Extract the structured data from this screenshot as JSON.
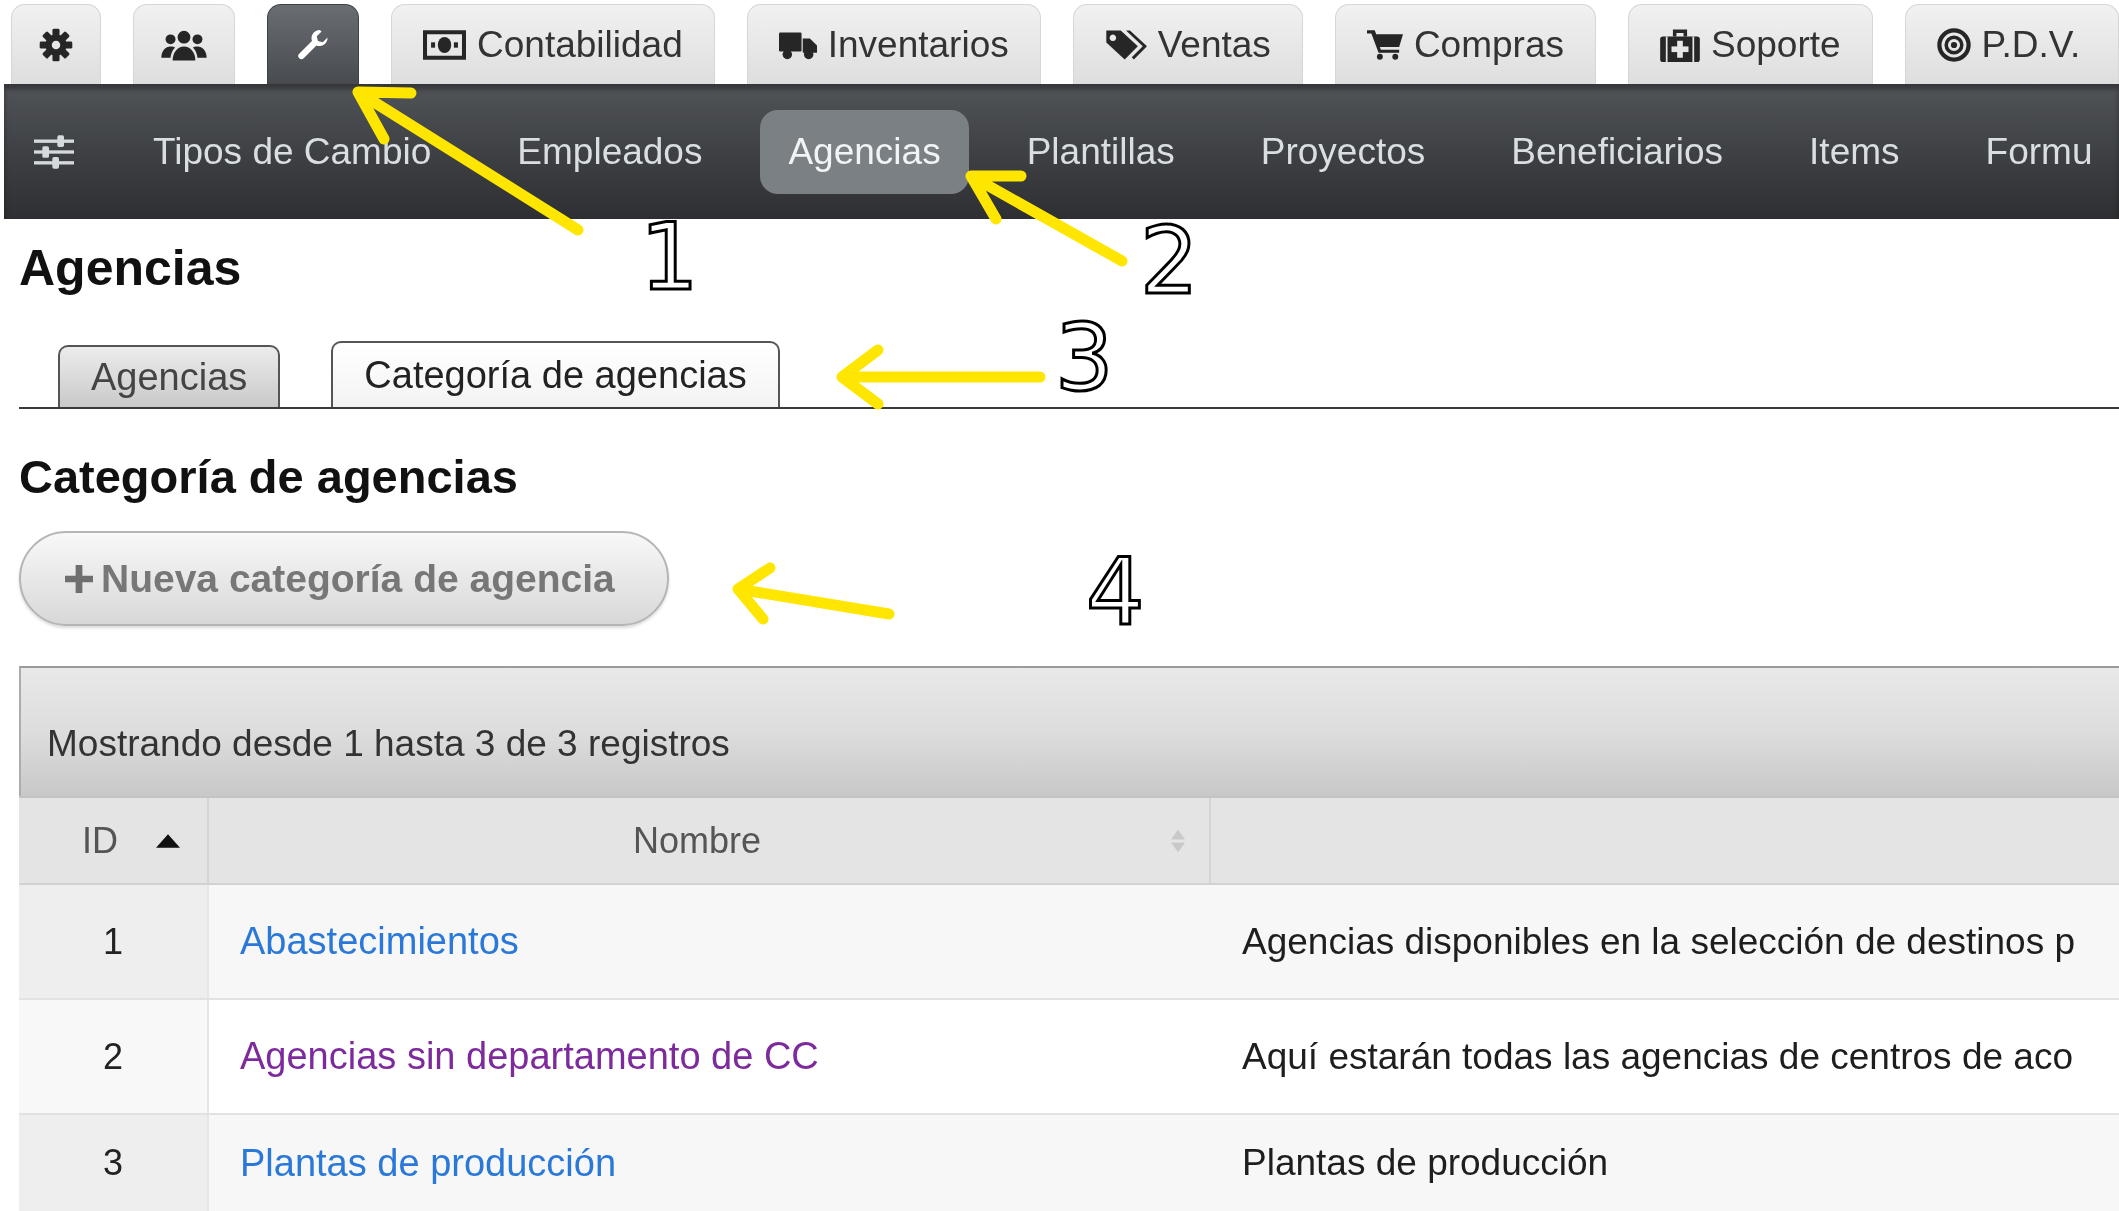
{
  "top_tabs": [
    {
      "selected": false
    },
    {
      "selected": false
    },
    {
      "selected": true
    },
    {
      "label": "Contabilidad",
      "selected": false
    },
    {
      "label": "Inventarios",
      "selected": false
    },
    {
      "label": "Ventas",
      "selected": false
    },
    {
      "label": "Compras",
      "selected": false
    },
    {
      "label": "Soporte",
      "selected": false
    },
    {
      "label": "P.D.V.",
      "selected": false
    }
  ],
  "nav": {
    "items": [
      {
        "label": "Tipos de Cambio",
        "selected": false
      },
      {
        "label": "Empleados",
        "selected": false
      },
      {
        "label": "Agencias",
        "selected": true
      },
      {
        "label": "Plantillas",
        "selected": false
      },
      {
        "label": "Proyectos",
        "selected": false
      },
      {
        "label": "Beneficiarios",
        "selected": false
      },
      {
        "label": "Items",
        "selected": false
      },
      {
        "label": "Formu",
        "selected": false
      }
    ]
  },
  "page_title": "Agencias",
  "subtabs": [
    {
      "label": "Agencias",
      "selected": false
    },
    {
      "label": "Categoría de agencias",
      "selected": true
    }
  ],
  "section_title": "Categoría de agencias",
  "new_button": {
    "label": "Nueva categoría de agencia"
  },
  "table": {
    "info": "Mostrando desde 1 hasta 3 de 3 registros",
    "columns": [
      {
        "label": "ID",
        "sorted": true
      },
      {
        "label": "Nombre",
        "sorted": false
      }
    ],
    "rows": [
      {
        "id": "1",
        "name": "Abastecimientos",
        "visited": false,
        "column_3": "Agencias disponibles en la selección de destinos p"
      },
      {
        "id": "2",
        "name": "Agencias sin departamento de CC",
        "visited": true,
        "column_3": "Aquí estarán todas las agencias de centros de aco"
      },
      {
        "id": "3",
        "name": "Plantas de producción",
        "visited": false,
        "column_3": "Plantas de producción"
      }
    ]
  },
  "annotations": [
    {
      "number": "1"
    },
    {
      "number": "2"
    },
    {
      "number": "3"
    },
    {
      "number": "4"
    }
  ]
}
